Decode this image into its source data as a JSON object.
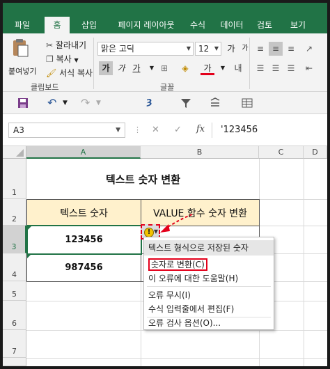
{
  "ribbon_tabs": [
    "파일",
    "홈",
    "삽입",
    "페이지 레이아웃",
    "수식",
    "데이터",
    "검토",
    "보기"
  ],
  "active_tab_index": 1,
  "clipboard": {
    "paste_label": "붙여넣기",
    "cut_label": "잘라내기",
    "copy_label": "복사",
    "format_painter_label": "서식 복사",
    "group_label": "클립보드"
  },
  "font": {
    "font_name": "맑은 고딕",
    "font_size": "12",
    "bold_label": "가",
    "italic_label": "가",
    "underline_label": "가",
    "increase_label": "가",
    "decrease_label": "가",
    "font_color_label": "가",
    "group_label": "글꼴"
  },
  "formula_bar": {
    "name_box": "A3",
    "cancel_glyph": "✕",
    "enter_glyph": "✓",
    "fx_label": "fx",
    "content": "'123456"
  },
  "columns": [
    "A",
    "B",
    "C",
    "D"
  ],
  "selected_column": "A",
  "rows": [
    "1",
    "2",
    "3",
    "4",
    "5",
    "6",
    "7"
  ],
  "selected_row": "3",
  "cells": {
    "title": "텍스트 숫자 변환",
    "header_a": "텍스트 숫자",
    "header_b": "VALUE 함수 숫자 변환",
    "a3": "123456",
    "a4": "987456"
  },
  "smart_tag": {
    "icon": "warning-icon",
    "glyph": "!"
  },
  "context_menu": {
    "items": [
      "텍스트 형식으로 저장된 숫자",
      "숫자로 변환(C)",
      "이 오류에 대한 도움말(H)",
      "오류 무시(I)",
      "수식 입력줄에서 편집(F)",
      "오류 검사 옵션(O)..."
    ],
    "highlighted_index": 1
  },
  "colors": {
    "ribbon_green": "#217346",
    "header_fill": "#fff1cc",
    "annotation_red": "#e3001b",
    "warning_yellow": "#f2c200"
  }
}
